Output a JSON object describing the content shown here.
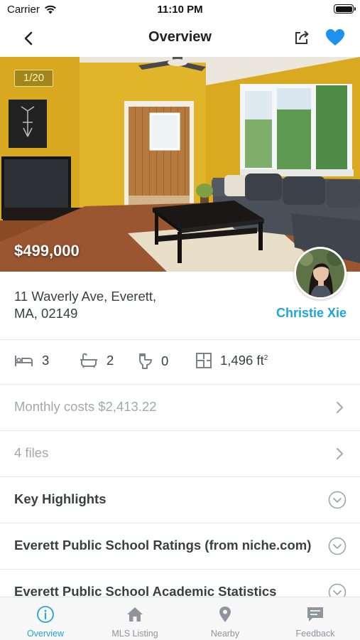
{
  "status_bar": {
    "carrier": "Carrier",
    "time": "11:10 PM"
  },
  "nav": {
    "title": "Overview",
    "back_icon": "chevron-left-icon",
    "share_icon": "share-icon",
    "favorite_icon": "heart-icon"
  },
  "listing": {
    "photo_counter": "1/20",
    "price": "$499,000",
    "address_line1": "11 Waverly Ave, Everett,",
    "address_line2": "MA, 02149",
    "agent_name": "Christie Xie"
  },
  "stats": [
    {
      "icon": "bed-icon",
      "value": "3"
    },
    {
      "icon": "bathtub-icon",
      "value": "2"
    },
    {
      "icon": "toilet-icon",
      "value": "0"
    },
    {
      "icon": "floorplan-icon",
      "value": "1,496 ft",
      "unit_sup": "2"
    }
  ],
  "rows": [
    {
      "label": "Monthly costs $2,413.22",
      "style": "muted",
      "indicator": "chevron-right-icon"
    },
    {
      "label": "4 files",
      "style": "muted",
      "indicator": "chevron-right-icon"
    },
    {
      "label": "Key Highlights",
      "style": "strong",
      "indicator": "chevron-down-circle-icon"
    },
    {
      "label": "Everett Public School Ratings (from niche.com)",
      "style": "strong",
      "indicator": "chevron-down-circle-icon"
    },
    {
      "label": "Everett Public School Academic Statistics",
      "style": "strong",
      "indicator": "chevron-down-circle-icon"
    }
  ],
  "tabs": [
    {
      "label": "Overview",
      "icon": "info-icon",
      "active": true
    },
    {
      "label": "MLS Listing",
      "icon": "home-icon",
      "active": false
    },
    {
      "label": "Nearby",
      "icon": "map-pin-icon",
      "active": false
    },
    {
      "label": "Feedback",
      "icon": "chat-icon",
      "active": false
    }
  ],
  "colors": {
    "accent": "#1ea5d9",
    "muted_text": "#a2a8ae",
    "body_text": "#3a3f44",
    "wall": "#e1b42a"
  }
}
